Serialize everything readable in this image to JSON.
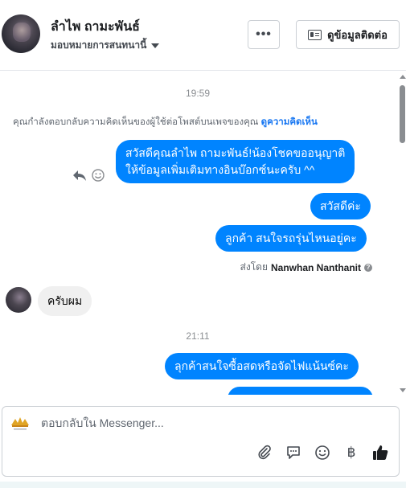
{
  "header": {
    "contact_name": "ลำไพ ถามะพันธ์",
    "assign_label": "มอบหมายการสนทนานี้",
    "more_label": "•••",
    "info_label": "ดูข้อมูลติดต่อ"
  },
  "chat": {
    "timestamp_1": "19:59",
    "notice_text": "คุณกำลังตอบกลับความคิดเห็นของผู้ใช้ต่อโพสต์บนเพจของคุณ",
    "notice_link": "ดูความคิดเห็น",
    "messages_out_1": [
      "สวัสดีคุณลำไพ ถามะพันธ์!น้องโชคขออนุญาติ",
      "ให้ข้อมูลเพิ่มเติมทางอินบ๊อกซ์นะครับ ^^"
    ],
    "message_out_2": "สวัสดีค่ะ",
    "message_out_3": "ลูกค้า สนใจรถรุ่นไหนอยู่คะ",
    "sent_by_prefix": "ส่งโดย",
    "sent_by_name": "Nanwhan Nanthanit",
    "help_mark": "?",
    "message_in_1": "ครับผม",
    "timestamp_2": "21:11",
    "message_out_4": "ลุกค้าสนใจซื้อสดหรือจัดไฟแน้นซ์คะ"
  },
  "composer": {
    "placeholder": "ตอบกลับใน Messenger...",
    "baht_symbol": "฿"
  },
  "colors": {
    "bubble_out": "#0084ff",
    "bubble_in": "#f0f0f0",
    "link": "#1877f2"
  },
  "icons": [
    "chevron-down-icon",
    "contact-card-icon",
    "reply-icon",
    "smile-icon",
    "help-icon",
    "paperclip-icon",
    "saved-reply-icon",
    "emoji-icon",
    "baht-icon",
    "thumbs-up-icon"
  ]
}
